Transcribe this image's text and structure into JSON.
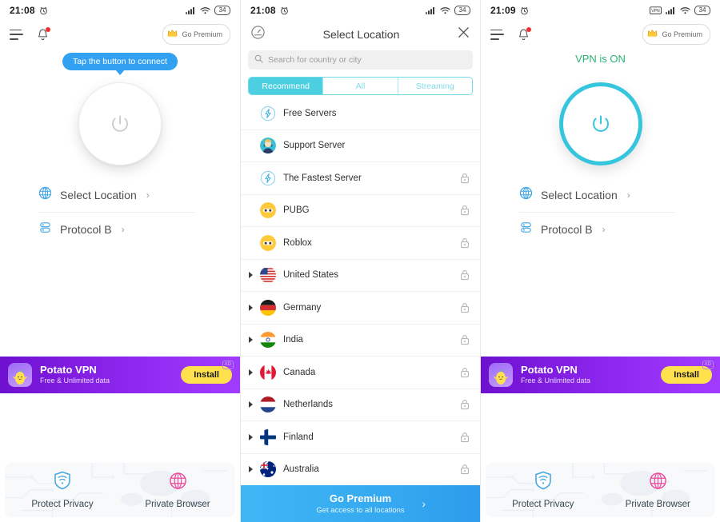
{
  "panels": [
    {
      "status": {
        "time": "21:08",
        "battery": "34",
        "alarm_icon": "alarm-icon",
        "signal_icon": "signal-icon",
        "wifi_icon": "wifi-icon",
        "vpn_icon": null
      },
      "appbar": {
        "menu_icon": "hamburger-icon",
        "bell_icon": "bell-icon",
        "premium_label": "Go Premium",
        "crown_icon": "crown-icon"
      },
      "tooltip": "Tap the button to connect",
      "power_state": "off",
      "menu": [
        {
          "label": "Select Location",
          "icon": "globe-icon",
          "chevron": "›"
        },
        {
          "label": "Protocol B",
          "icon": "protocol-icon",
          "chevron": "›"
        }
      ],
      "ad": {
        "title": "Potato VPN",
        "subtitle": "Free & Unlimited data",
        "cta": "Install",
        "badge": "AD",
        "app_icon": "potato-app-icon"
      },
      "features": [
        {
          "label": "Protect Privacy",
          "icon": "shield-icon",
          "color": "#4aa8e0"
        },
        {
          "label": "Private Browser",
          "icon": "globe-pink-icon",
          "color": "#ec4899"
        }
      ]
    },
    {
      "status": {
        "time": "21:08",
        "battery": "34",
        "alarm_icon": "alarm-icon",
        "signal_icon": "signal-icon",
        "wifi_icon": "wifi-icon",
        "vpn_icon": null
      },
      "header": {
        "speed_icon": "speedometer-icon",
        "title": "Select Location",
        "close_icon": "close-icon"
      },
      "search": {
        "placeholder": "Search for country or city",
        "icon": "search-icon",
        "value": ""
      },
      "tabs": [
        {
          "label": "Recommend",
          "active": true
        },
        {
          "label": "All",
          "active": false
        },
        {
          "label": "Streaming",
          "active": false
        }
      ],
      "locations": [
        {
          "name": "Free Servers",
          "icon": "bolt-icon",
          "locked": false,
          "expandable": false
        },
        {
          "name": "Support Server",
          "icon": "support-avatar-icon",
          "locked": false,
          "expandable": false
        },
        {
          "name": "The Fastest Server",
          "icon": "bolt-icon",
          "locked": true,
          "expandable": false
        },
        {
          "name": "PUBG",
          "icon": "pubg-icon",
          "locked": true,
          "expandable": false
        },
        {
          "name": "Roblox",
          "icon": "roblox-icon",
          "locked": true,
          "expandable": false
        },
        {
          "name": "United States",
          "icon": "flag-us",
          "locked": true,
          "expandable": true
        },
        {
          "name": "Germany",
          "icon": "flag-de",
          "locked": true,
          "expandable": true
        },
        {
          "name": "India",
          "icon": "flag-in",
          "locked": true,
          "expandable": true
        },
        {
          "name": "Canada",
          "icon": "flag-ca",
          "locked": true,
          "expandable": true
        },
        {
          "name": "Netherlands",
          "icon": "flag-nl",
          "locked": true,
          "expandable": true
        },
        {
          "name": "Finland",
          "icon": "flag-fi",
          "locked": true,
          "expandable": true
        },
        {
          "name": "Australia",
          "icon": "flag-au",
          "locked": true,
          "expandable": true
        }
      ],
      "go_premium": {
        "title": "Go Premium",
        "subtitle": "Get access to all locations",
        "chevron": "›"
      }
    },
    {
      "status": {
        "time": "21:09",
        "battery": "34",
        "alarm_icon": "alarm-icon",
        "signal_icon": "signal-icon",
        "wifi_icon": "wifi-icon",
        "vpn_icon": "vpn-badge-icon"
      },
      "appbar": {
        "menu_icon": "hamburger-icon",
        "bell_icon": "bell-icon",
        "premium_label": "Go Premium",
        "crown_icon": "crown-icon"
      },
      "vpn_state_text": "VPN is ON",
      "power_state": "on",
      "menu": [
        {
          "label": "Select Location",
          "icon": "globe-icon",
          "chevron": "›"
        },
        {
          "label": "Protocol B",
          "icon": "protocol-icon",
          "chevron": "›"
        }
      ],
      "ad": {
        "title": "Potato VPN",
        "subtitle": "Free & Unlimited data",
        "cta": "Install",
        "badge": "AD",
        "app_icon": "potato-app-icon"
      },
      "features": [
        {
          "label": "Protect Privacy",
          "icon": "shield-icon",
          "color": "#4aa8e0"
        },
        {
          "label": "Private Browser",
          "icon": "globe-pink-icon",
          "color": "#ec4899"
        }
      ]
    }
  ],
  "colors": {
    "accent_teal": "#35c6de",
    "accent_blue": "#33a1f2",
    "on_green": "#27b473",
    "ad_purple": "#8f28ef",
    "install_yellow": "#ffe14d",
    "lock_gray": "#b5b5b5"
  }
}
